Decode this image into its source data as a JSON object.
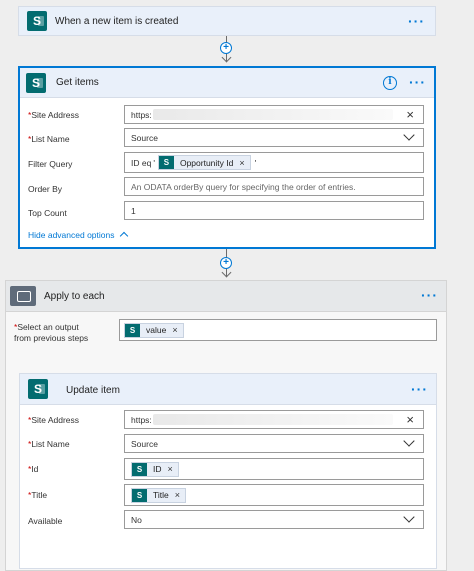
{
  "trigger": {
    "title": "When a new item is created",
    "menu": "···"
  },
  "get_items": {
    "title": "Get items",
    "menu": "···",
    "info": "i",
    "fields": {
      "site_address": {
        "label": "Site Address",
        "value": "https:"
      },
      "list_name": {
        "label": "List Name",
        "value": "Source"
      },
      "filter_query": {
        "label": "Filter Query",
        "prefix": "ID eq",
        "quote_open": "'",
        "token": "Opportunity Id",
        "quote_close": "'"
      },
      "order_by": {
        "label": "Order By",
        "placeholder": "An ODATA orderBy query for specifying the order of entries."
      },
      "top_count": {
        "label": "Top Count",
        "value": "1"
      }
    },
    "advanced_link": "Hide advanced options"
  },
  "apply_each": {
    "title": "Apply to each",
    "menu": "···",
    "select_label_line1": "Select an output",
    "select_label_line2": "from previous steps",
    "token": "value"
  },
  "update_item": {
    "title": "Update item",
    "menu": "···",
    "fields": {
      "site_address": {
        "label": "Site Address",
        "value": "https:"
      },
      "list_name": {
        "label": "List Name",
        "value": "Source"
      },
      "id": {
        "label": "Id",
        "token": "ID"
      },
      "title": {
        "label": "Title",
        "token": "Title"
      },
      "available": {
        "label": "Available",
        "value": "No"
      }
    }
  },
  "icons": {
    "sharepoint": "S",
    "remove": "×",
    "required": "*",
    "plus": "+"
  },
  "colors": {
    "accent": "#0078d4",
    "sharepoint": "#036c70",
    "loop": "#5f6b7a",
    "required": "#cc0000"
  }
}
